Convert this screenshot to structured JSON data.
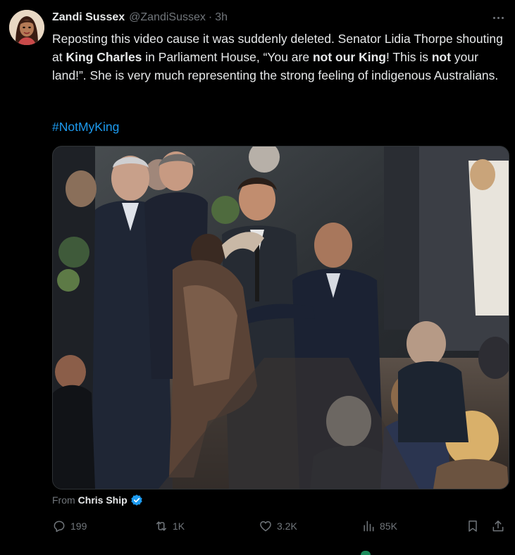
{
  "author": {
    "display_name": "Zandi Sussex",
    "handle": "@ZandiSussex",
    "separator": "·",
    "time": "3h"
  },
  "tweet": {
    "segments": [
      {
        "text": "Reposting this video cause it was suddenly deleted. Senator Lidia Thorpe shouting at ",
        "bold": false
      },
      {
        "text": "King Charles",
        "bold": true
      },
      {
        "text": " in Parliament House, “You are ",
        "bold": false
      },
      {
        "text": "not our King",
        "bold": true
      },
      {
        "text": "! This is ",
        "bold": false
      },
      {
        "text": "not",
        "bold": true
      },
      {
        "text": " your land!”. She is very much representing the strong feeling of indigenous Australians.",
        "bold": false
      }
    ],
    "hashtag": "#NotMyKing"
  },
  "media": {
    "attribution_prefix": "From",
    "attribution_name": "Chris Ship"
  },
  "actions": {
    "replies": "199",
    "reposts": "1K",
    "likes": "3.2K",
    "views": "85K"
  },
  "icons": {
    "more": "more-dots-icon",
    "verified": "verified-badge-icon",
    "reply": "reply-icon",
    "repost": "repost-icon",
    "like": "heart-icon",
    "views": "views-chart-icon",
    "bookmark": "bookmark-icon",
    "share": "share-icon"
  },
  "colors": {
    "background": "#000000",
    "text": "#e7e9ea",
    "muted": "#71767b",
    "link": "#1d9bf0",
    "verified": "#1d9bf0"
  }
}
